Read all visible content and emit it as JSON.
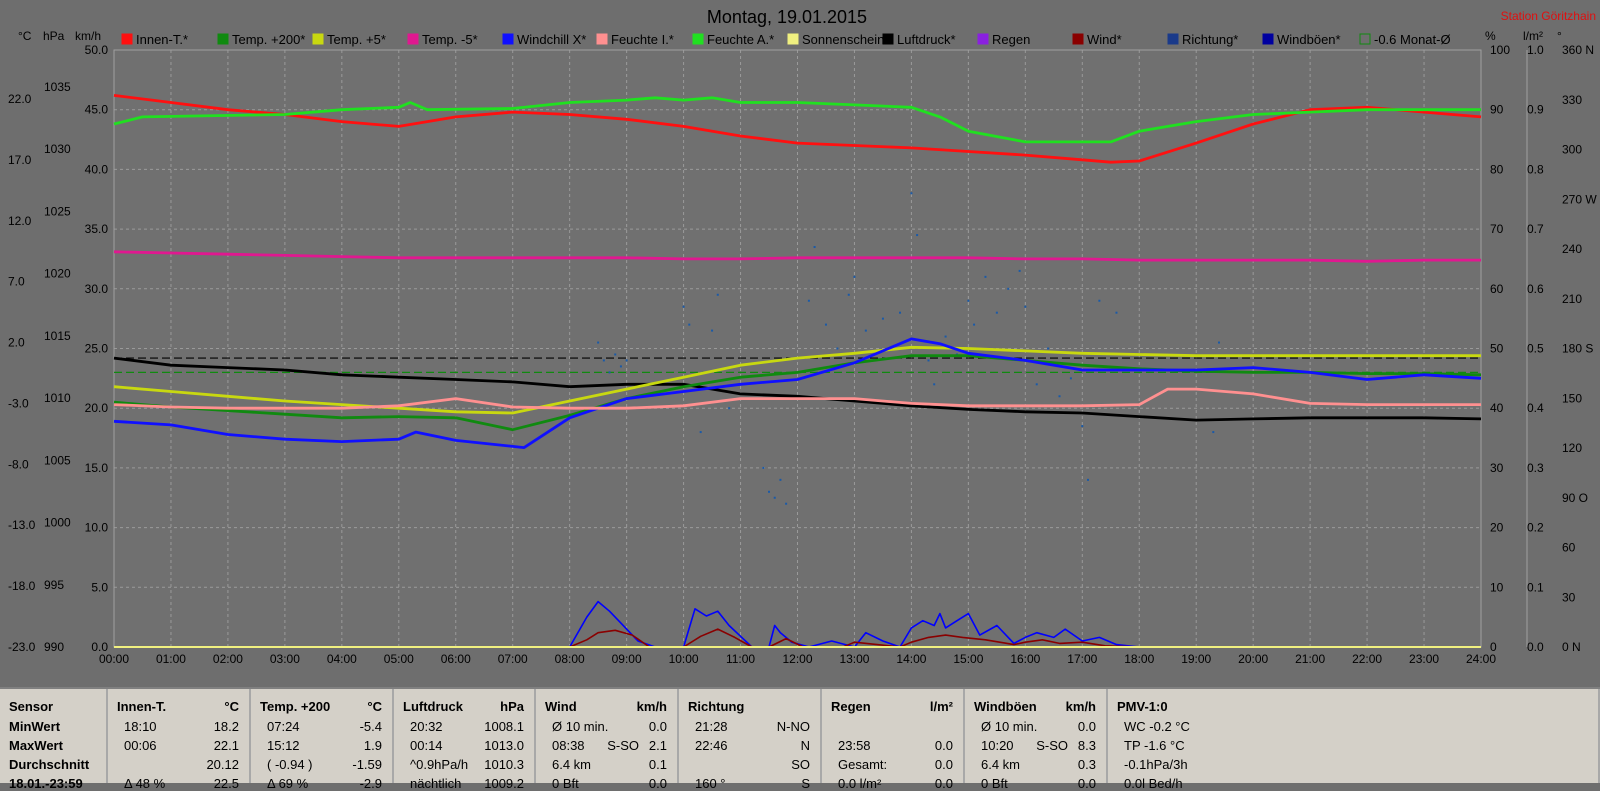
{
  "title": "Montag, 19.01.2015",
  "station": "Station Göritzhain",
  "axis_units": {
    "temp": "°C",
    "hpa": "hPa",
    "kmh": "km/h",
    "pct": "%",
    "rain": "l/m²",
    "deg": "°"
  },
  "legend": [
    {
      "label": "Innen-T.*",
      "color": "#ff1010"
    },
    {
      "label": "Temp. +200*",
      "color": "#108a10"
    },
    {
      "label": "Temp. +5*",
      "color": "#c8d810"
    },
    {
      "label": "Temp. -5*",
      "color": "#e01890"
    },
    {
      "label": "Windchill X*",
      "color": "#1010ff"
    },
    {
      "label": "Feuchte I.*",
      "color": "#ff9090"
    },
    {
      "label": "Feuchte A.*",
      "color": "#20e020"
    },
    {
      "label": "Sonnenschein",
      "color": "#f0f080"
    },
    {
      "label": "Luftdruck*",
      "color": "#000000"
    },
    {
      "label": "Regen",
      "color": "#8a20e0"
    },
    {
      "label": "Wind*",
      "color": "#8a0000"
    },
    {
      "label": "Richtung*",
      "color": "#1a3a8a"
    },
    {
      "label": "Windböen*",
      "color": "#0000a0"
    },
    {
      "label": "-0.6 Monat-Ø",
      "color": "#108a10"
    }
  ],
  "chart_data": {
    "type": "line",
    "title": "Montag, 19.01.2015",
    "x_labels": [
      "00:00",
      "01:00",
      "02:00",
      "03:00",
      "04:00",
      "05:00",
      "06:00",
      "07:00",
      "08:00",
      "09:00",
      "10:00",
      "11:00",
      "12:00",
      "13:00",
      "14:00",
      "15:00",
      "16:00",
      "17:00",
      "18:00",
      "19:00",
      "20:00",
      "21:00",
      "22:00",
      "23:00",
      "24:00"
    ],
    "x_range": [
      0,
      24
    ],
    "axes": {
      "temp": {
        "ticks": [
          "22.0",
          "17.0",
          "12.0",
          "7.0",
          "2.0",
          "-3.0",
          "-8.0",
          "-13.0",
          "-18.0",
          "-23.0"
        ]
      },
      "hpa": {
        "ticks": [
          "1035",
          "1030",
          "1025",
          "1020",
          "1015",
          "1010",
          "1005",
          "1000",
          "995",
          "990"
        ]
      },
      "kmh": {
        "ticks": [
          "50.0",
          "45.0",
          "40.0",
          "35.0",
          "30.0",
          "25.0",
          "20.0",
          "15.0",
          "10.0",
          "5.0",
          "0.0"
        ],
        "range": [
          0,
          50
        ]
      },
      "pct": {
        "ticks": [
          "100",
          "90",
          "80",
          "70",
          "60",
          "50",
          "40",
          "30",
          "20",
          "10",
          "0"
        ]
      },
      "rain": {
        "ticks": [
          "1.0",
          "0.9",
          "0.8",
          "0.7",
          "0.6",
          "0.5",
          "0.4",
          "0.3",
          "0.2",
          "0.1",
          "0.0"
        ]
      },
      "deg": {
        "ticks": [
          "360 N",
          "330",
          "300",
          "270 W",
          "240",
          "210",
          "180 S",
          "150",
          "120",
          "90 O",
          "60",
          "30",
          "0 N"
        ]
      }
    },
    "grid": true,
    "series": [
      {
        "name": "Innen-T.*",
        "color": "#ff1010",
        "x": [
          0,
          1,
          2,
          3,
          4,
          5,
          6,
          7,
          8,
          9,
          10,
          11,
          12,
          13,
          14,
          15,
          16,
          17,
          17.5,
          18,
          19,
          20,
          21,
          22,
          23,
          24
        ],
        "y": [
          46.2,
          45.6,
          45.0,
          44.6,
          44.0,
          43.6,
          44.4,
          44.8,
          44.6,
          44.2,
          43.6,
          42.8,
          42.2,
          42.0,
          41.8,
          41.5,
          41.2,
          40.8,
          40.6,
          40.7,
          42.2,
          43.8,
          45.0,
          45.2,
          44.8,
          44.4
        ]
      },
      {
        "name": "Feuchte A.*",
        "color": "#20e020",
        "x": [
          0,
          0.5,
          3,
          4,
          5,
          5.2,
          5.5,
          7,
          8,
          9,
          9.5,
          10,
          10.5,
          11,
          12,
          13,
          14,
          14.5,
          15,
          16,
          17,
          17.5,
          18,
          19,
          20,
          21,
          22,
          23,
          24
        ],
        "y": [
          43.8,
          44.4,
          44.6,
          45.0,
          45.2,
          45.6,
          45.0,
          45.1,
          45.6,
          45.8,
          46.0,
          45.8,
          46.0,
          45.6,
          45.6,
          45.4,
          45.2,
          44.4,
          43.2,
          42.3,
          42.3,
          42.3,
          43.2,
          44.0,
          44.6,
          44.8,
          45.0,
          45.0,
          45.0
        ]
      },
      {
        "name": "Temp. -5*",
        "color": "#e01890",
        "x": [
          0,
          1,
          2,
          3,
          4,
          5,
          6,
          7,
          8,
          9,
          10,
          11,
          12,
          13,
          14,
          15,
          16,
          17,
          18,
          19,
          20,
          21,
          22,
          23,
          24
        ],
        "y": [
          33.1,
          33.0,
          32.9,
          32.8,
          32.7,
          32.6,
          32.6,
          32.6,
          32.6,
          32.6,
          32.5,
          32.5,
          32.6,
          32.6,
          32.6,
          32.6,
          32.5,
          32.5,
          32.4,
          32.4,
          32.4,
          32.4,
          32.3,
          32.4,
          32.4
        ]
      },
      {
        "name": "Luftdruck*",
        "color": "#000000",
        "x": [
          0,
          1,
          2,
          3,
          4,
          5,
          6,
          7,
          8,
          9,
          10,
          11,
          12,
          13,
          14,
          15,
          16,
          17,
          18,
          19,
          20,
          21,
          22,
          23,
          24
        ],
        "y": [
          24.2,
          23.6,
          23.4,
          23.2,
          22.8,
          22.6,
          22.4,
          22.2,
          21.8,
          22.0,
          22.0,
          21.2,
          21.0,
          20.6,
          20.2,
          19.9,
          19.7,
          19.6,
          19.3,
          19.0,
          19.1,
          19.2,
          19.2,
          19.2,
          19.1
        ]
      },
      {
        "name": "Temp. +5*",
        "color": "#c8d810",
        "x": [
          0,
          1,
          2,
          3,
          4,
          5,
          6,
          7,
          8,
          9,
          10,
          11,
          12,
          13,
          14,
          15,
          16,
          17,
          18,
          19,
          20,
          21,
          22,
          23,
          24
        ],
        "y": [
          21.8,
          21.4,
          21.0,
          20.6,
          20.3,
          20.0,
          19.7,
          19.6,
          20.6,
          21.6,
          22.6,
          23.6,
          24.2,
          24.6,
          25.1,
          25.0,
          24.8,
          24.6,
          24.5,
          24.4,
          24.4,
          24.4,
          24.4,
          24.4,
          24.4
        ]
      },
      {
        "name": "Temp. +200*",
        "color": "#108a10",
        "x": [
          0,
          1,
          2,
          3,
          4,
          5,
          6,
          7,
          8,
          9,
          10,
          11,
          12,
          13,
          14,
          15,
          16,
          17,
          18,
          19,
          20,
          21,
          22,
          23,
          24
        ],
        "y": [
          20.5,
          20.1,
          19.8,
          19.5,
          19.2,
          19.3,
          19.2,
          18.2,
          19.4,
          20.8,
          21.8,
          22.6,
          23.0,
          23.8,
          24.4,
          24.4,
          24.0,
          23.6,
          23.3,
          23.1,
          23.0,
          23.0,
          22.9,
          22.9,
          22.8
        ]
      },
      {
        "name": "Windchill X*",
        "color": "#1010ff",
        "x": [
          0,
          1,
          2,
          3,
          4,
          5,
          5.3,
          6,
          7,
          7.2,
          8,
          9,
          10,
          11,
          12,
          13,
          14,
          14.5,
          15,
          16,
          17,
          18,
          19,
          20,
          21,
          22,
          23,
          24
        ],
        "y": [
          18.9,
          18.6,
          17.8,
          17.4,
          17.2,
          17.4,
          18.0,
          17.3,
          16.8,
          16.7,
          19.2,
          20.8,
          21.4,
          22.0,
          22.4,
          23.8,
          25.8,
          25.4,
          24.6,
          24.0,
          23.2,
          23.2,
          23.2,
          23.4,
          23.0,
          22.4,
          22.8,
          22.5
        ]
      },
      {
        "name": "Feuchte I.*",
        "color": "#ff9090",
        "x": [
          0,
          1,
          2,
          3,
          4,
          5,
          6,
          7,
          8,
          9,
          10,
          11,
          12,
          13,
          14,
          15,
          16,
          17,
          18,
          18.5,
          19,
          20,
          21,
          22,
          23,
          24
        ],
        "y": [
          20.3,
          20.1,
          20.0,
          20.0,
          20.0,
          20.2,
          20.8,
          20.1,
          20.0,
          20.0,
          20.2,
          20.8,
          20.8,
          20.8,
          20.4,
          20.2,
          20.2,
          20.2,
          20.3,
          21.6,
          21.6,
          21.2,
          20.4,
          20.3,
          20.3,
          20.3
        ]
      },
      {
        "name": "Windböen*",
        "color": "#0000ff",
        "x": [
          0,
          8,
          8.3,
          8.5,
          8.7,
          8.9,
          9.2,
          9.5,
          10,
          10.2,
          10.4,
          10.6,
          10.8,
          11.2,
          11.5,
          11.6,
          11.7,
          11.9,
          12.2,
          12.6,
          13,
          13.2,
          13.5,
          13.8,
          14,
          14.2,
          14.4,
          14.5,
          14.6,
          14.8,
          15,
          15.2,
          15.5,
          15.8,
          16,
          16.2,
          16.5,
          16.7,
          17,
          17.3,
          17.6,
          18,
          24
        ],
        "y": [
          0,
          0,
          2.5,
          3.8,
          3.0,
          2.0,
          0.5,
          0,
          0,
          3.2,
          2.6,
          3.0,
          1.8,
          0,
          0,
          1.8,
          1.2,
          0.4,
          0,
          0.5,
          0,
          1.2,
          0.5,
          0,
          1.6,
          2.2,
          1.8,
          2.8,
          1.6,
          2.2,
          2.8,
          1.0,
          1.8,
          0.3,
          0.8,
          1.2,
          0.8,
          1.5,
          0.5,
          0.8,
          0.2,
          0,
          0
        ]
      },
      {
        "name": "Wind*",
        "color": "#8a0000",
        "x": [
          0,
          8,
          8.3,
          8.5,
          8.8,
          9.1,
          9.4,
          10,
          10.3,
          10.6,
          10.9,
          11.2,
          11.5,
          11.8,
          12.1,
          12.8,
          13,
          13.4,
          13.8,
          14,
          14.3,
          14.6,
          14.9,
          15.3,
          15.8,
          16,
          16.3,
          16.6,
          17,
          17.4,
          18,
          24
        ],
        "y": [
          0,
          0,
          0.6,
          1.2,
          1.4,
          1.0,
          0,
          0,
          0.9,
          1.5,
          0.8,
          0,
          0,
          0.7,
          0,
          0,
          0.4,
          0.2,
          0,
          0.4,
          0.8,
          1.0,
          0.8,
          0.6,
          0.2,
          0.4,
          0.6,
          0.3,
          0.4,
          0.1,
          0,
          0
        ]
      }
    ],
    "scatter": {
      "name": "Richtung*",
      "color": "#1a5aa8",
      "x": [
        8.5,
        8.6,
        8.7,
        8.8,
        8.9,
        9.0,
        10.0,
        10.1,
        10.3,
        10.5,
        10.6,
        10.8,
        11.4,
        11.5,
        11.6,
        11.7,
        11.8,
        12.2,
        12.3,
        12.5,
        12.7,
        12.9,
        13.0,
        13.2,
        13.5,
        13.8,
        14.0,
        14.1,
        14.3,
        14.4,
        14.6,
        14.8,
        15.0,
        15.1,
        15.3,
        15.5,
        15.7,
        15.9,
        16.0,
        16.2,
        16.4,
        16.6,
        16.8,
        17.0,
        17.1,
        17.3,
        17.6,
        19.3,
        19.4
      ],
      "y": [
        25.5,
        24.0,
        23.0,
        24.5,
        23.5,
        24.0,
        28.5,
        27.0,
        18.0,
        26.5,
        29.5,
        20.0,
        15.0,
        13.0,
        12.5,
        14.0,
        12.0,
        29.0,
        33.5,
        27.0,
        25.0,
        29.5,
        31.0,
        26.5,
        27.5,
        28.0,
        38.0,
        34.5,
        24.0,
        22.0,
        26.0,
        24.5,
        29.0,
        27.0,
        31.0,
        28.0,
        30.0,
        31.5,
        28.5,
        22.0,
        25.0,
        21.0,
        22.5,
        18.5,
        14.0,
        29.0,
        28.0,
        18.0,
        25.5
      ]
    },
    "reference_lines": [
      {
        "name": "dashed-black",
        "y": 24.2,
        "color": "#000000"
      },
      {
        "name": "-0.6 Monat-Ø",
        "y": 23.0,
        "color": "#108a10"
      }
    ]
  },
  "stats": {
    "columns": [
      {
        "header": "Sensor",
        "unit": "",
        "rows": [
          {
            "a": "MinWert",
            "b": "",
            "c": ""
          },
          {
            "a": "MaxWert",
            "b": "",
            "c": ""
          },
          {
            "a": "Durchschnitt",
            "b": "",
            "c": ""
          },
          {
            "a": "18.01.-23:59",
            "b": "",
            "c": ""
          }
        ]
      },
      {
        "header": "Innen-T.",
        "unit": "°C",
        "rows": [
          {
            "a": "18:10",
            "b": "",
            "c": "18.2"
          },
          {
            "a": "00:06",
            "b": "",
            "c": "22.1"
          },
          {
            "a": "",
            "b": "",
            "c": "20.12"
          },
          {
            "a": "Δ 48 %",
            "b": "",
            "c": "22.5"
          }
        ]
      },
      {
        "header": "Temp. +200",
        "unit": "°C",
        "rows": [
          {
            "a": "07:24",
            "b": "",
            "c": "-5.4"
          },
          {
            "a": "15:12",
            "b": "",
            "c": "1.9"
          },
          {
            "a": "( -0.94 )",
            "b": "",
            "c": "-1.59"
          },
          {
            "a": "Δ 69 %",
            "b": "",
            "c": "-2.9"
          }
        ]
      },
      {
        "header": "Luftdruck",
        "unit": "hPa",
        "rows": [
          {
            "a": "20:32",
            "b": "",
            "c": "1008.1"
          },
          {
            "a": "00:14",
            "b": "",
            "c": "1013.0"
          },
          {
            "a": "^0.9hPa/h",
            "b": "",
            "c": "1010.3"
          },
          {
            "a": "nächtlich",
            "b": "",
            "c": "1009.2"
          }
        ]
      },
      {
        "header": "Wind",
        "unit": "km/h",
        "rows": [
          {
            "a": "Ø 10 min.",
            "b": "",
            "c": "0.0"
          },
          {
            "a": "08:38",
            "b": "S-SO",
            "c": "2.1"
          },
          {
            "a": "6.4 km",
            "b": "",
            "c": "0.1"
          },
          {
            "a": "0 Bft",
            "b": "",
            "c": "0.0"
          }
        ]
      },
      {
        "header": "Richtung",
        "unit": "",
        "rows": [
          {
            "a": "21:28",
            "b": "",
            "c": "N-NO"
          },
          {
            "a": "22:46",
            "b": "",
            "c": "N"
          },
          {
            "a": "",
            "b": "",
            "c": "SO"
          },
          {
            "a": "160 °",
            "b": "",
            "c": "S"
          }
        ]
      },
      {
        "header": "Regen",
        "unit": "l/m²",
        "rows": [
          {
            "a": "",
            "b": "",
            "c": ""
          },
          {
            "a": "23:58",
            "b": "",
            "c": "0.0"
          },
          {
            "a": "Gesamt:",
            "b": "",
            "c": "0.0"
          },
          {
            "a": "0.0 l/m²",
            "b": "",
            "c": "0.0"
          }
        ]
      },
      {
        "header": "Windböen",
        "unit": "km/h",
        "rows": [
          {
            "a": "Ø 10 min.",
            "b": "",
            "c": "0.0"
          },
          {
            "a": "10:20",
            "b": "S-SO",
            "c": "8.3"
          },
          {
            "a": "6.4 km",
            "b": "",
            "c": "0.3"
          },
          {
            "a": "0 Bft",
            "b": "",
            "c": "0.0"
          }
        ]
      },
      {
        "header": "PMV-1:0",
        "unit": "",
        "rows": [
          {
            "a": "WC -0.2 °C",
            "b": "",
            "c": ""
          },
          {
            "a": "TP -1.6 °C",
            "b": "",
            "c": ""
          },
          {
            "a": "-0.1hPa/3h",
            "b": "",
            "c": ""
          },
          {
            "a": "0.0l Bed/h",
            "b": "",
            "c": ""
          }
        ]
      }
    ]
  }
}
